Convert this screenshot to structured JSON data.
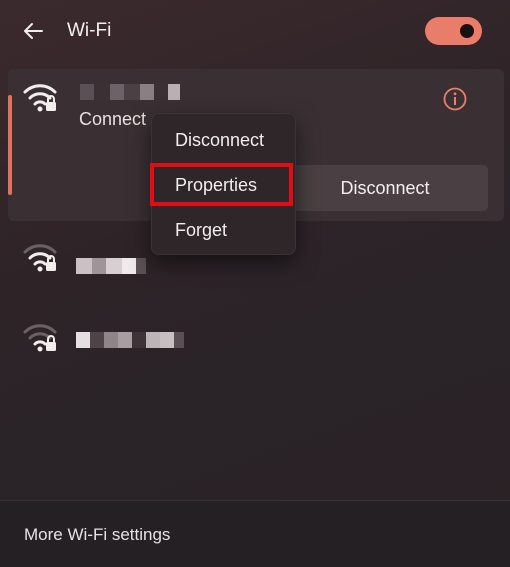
{
  "header": {
    "title": "Wi-Fi",
    "toggle_on": true
  },
  "networks": {
    "active": {
      "status_text": "Connect",
      "disconnect_label": "Disconnect"
    }
  },
  "context_menu": {
    "items": [
      "Disconnect",
      "Properties",
      "Forget"
    ],
    "highlighted": "Properties"
  },
  "footer": {
    "link_label": "More Wi-Fi settings"
  },
  "colors": {
    "accent": "#ea7d69",
    "highlight_box": "#e00e14"
  }
}
